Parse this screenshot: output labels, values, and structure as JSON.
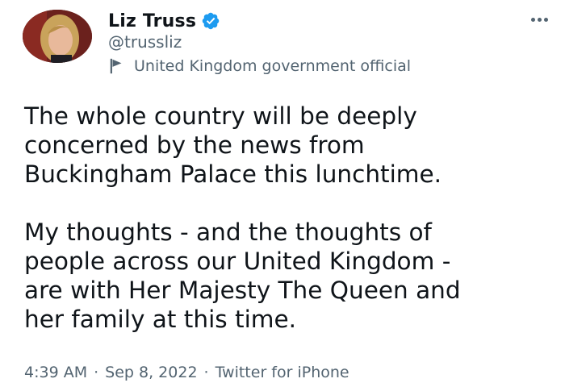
{
  "author": {
    "display_name": "Liz Truss",
    "handle": "@trussliz",
    "verified": true,
    "affiliation": "United Kingdom government official",
    "avatar_icon": "profile-photo"
  },
  "tweet": {
    "paragraphs": [
      [
        "The whole country will be deeply",
        "concerned by the news from",
        "Buckingham Palace this lunchtime."
      ],
      [
        "My thoughts - and the thoughts of",
        "people across our United Kingdom -",
        "are with Her Majesty The Queen and",
        "her family at this time."
      ]
    ]
  },
  "meta": {
    "time": "4:39 AM",
    "separator": "·",
    "date": "Sep 8, 2022",
    "source": "Twitter for iPhone"
  },
  "colors": {
    "verified_blue": "#1d9bf0",
    "text_primary": "#0f1419",
    "text_secondary": "#536471"
  },
  "icons": {
    "verified": "verified-badge-icon",
    "affiliation": "flag-icon",
    "more": "more-horizontal-icon"
  }
}
